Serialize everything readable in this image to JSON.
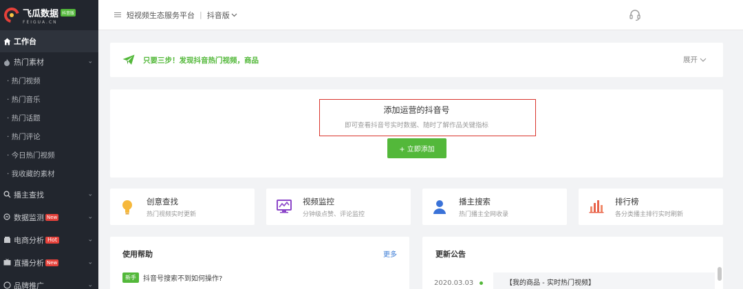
{
  "logo": {
    "name": "飞瓜数据",
    "badge": "抖音版",
    "sub": "FEIGUA.CN"
  },
  "header": {
    "title": "短视频生态服务平台",
    "separator": "|",
    "subtitle": "抖音版"
  },
  "sidebar": {
    "workbench": "工作台",
    "hot_material": "热门素材",
    "sub_items": [
      "· 热门视频",
      "· 热门音乐",
      "· 热门话题",
      "· 热门评论",
      "· 今日热门视频",
      "· 我收藏的素材"
    ],
    "anchor_search": "播主查找",
    "data_monitor": "数据监测",
    "data_monitor_tag": "New",
    "ecommerce": "电商分析",
    "ecommerce_tag": "Hot",
    "live": "直播分析",
    "live_tag": "New",
    "brand": "品牌推广"
  },
  "banner": {
    "text": "只要三步！发现抖音热门视频，商品",
    "expand": "展开"
  },
  "add_card": {
    "title": "添加运营的抖音号",
    "desc": "即可查看抖音号实时数据、随时了解作品关键指标",
    "button": "+ 立即添加"
  },
  "features": [
    {
      "title": "创意查找",
      "desc": "热门视频实时更新",
      "icon": "lightbulb-icon"
    },
    {
      "title": "视频监控",
      "desc": "分钟级点赞、评论监控",
      "icon": "monitor-chart-icon"
    },
    {
      "title": "播主搜索",
      "desc": "热门播主全网收录",
      "icon": "user-icon"
    },
    {
      "title": "排行榜",
      "desc": "各分类播主排行实时刷新",
      "icon": "bar-chart-icon"
    }
  ],
  "help": {
    "title": "使用帮助",
    "more": "更多",
    "tag": "新手",
    "question": "抖音号搜索不到如何操作?"
  },
  "notice": {
    "title": "更新公告",
    "date": "2020.03.03",
    "item": "【我的商品 - 实时热门视频】"
  },
  "colors": {
    "sidebar_bg": "#22262e",
    "accent_green": "#53b83a",
    "highlight_red": "#d9322a",
    "link_blue": "#3a7bd5"
  }
}
